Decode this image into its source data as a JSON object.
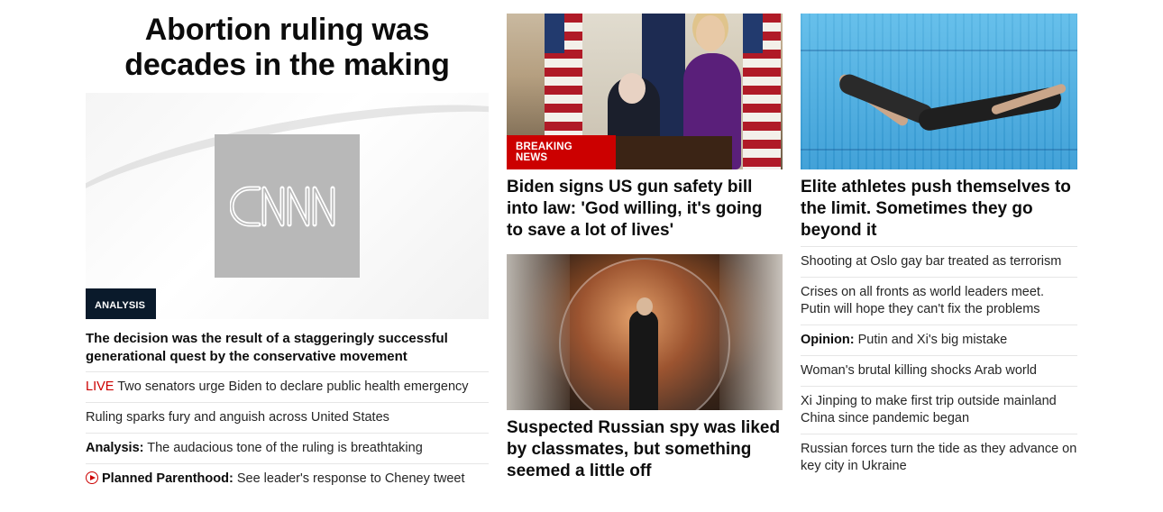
{
  "col1": {
    "headline": "Abortion ruling was decades in the making",
    "badge": "ANALYSIS",
    "lead": "The decision was the result of a staggeringly successful generational quest by the conservative movement",
    "items": [
      {
        "live": "LIVE",
        "text": " Two senators urge Biden to declare public health emergency"
      },
      {
        "text": "Ruling sparks fury and anguish across United States"
      },
      {
        "bold": "Analysis:",
        "text": " The audacious tone of the ruling is breathtaking"
      },
      {
        "icon": "play-icon",
        "bold": "Planned Parenthood:",
        "text": " See leader's response to Cheney tweet"
      }
    ]
  },
  "col2": {
    "badge": "BREAKING NEWS",
    "headline1": "Biden signs US gun safety bill into law: 'God willing, it's going to save a lot of lives'",
    "headline2": "Suspected Russian spy was liked by classmates, but something seemed a little off"
  },
  "col3": {
    "headline": "Elite athletes push themselves to the limit. Sometimes they go beyond it",
    "items": [
      {
        "text": "Shooting at Oslo gay bar treated as terrorism"
      },
      {
        "text": "Crises on all fronts as world leaders meet. Putin will hope they can't fix the problems"
      },
      {
        "bold": "Opinion:",
        "text": " Putin and Xi's big mistake"
      },
      {
        "text": "Woman's brutal killing shocks Arab world"
      },
      {
        "text": "Xi Jinping to make first trip outside mainland China since pandemic began"
      },
      {
        "text": "Russian forces turn the tide as they advance on key city in Ukraine"
      }
    ]
  },
  "colors": {
    "breaking": "#cc0000",
    "analysis": "#0a1a2b",
    "live": "#cc0000"
  }
}
